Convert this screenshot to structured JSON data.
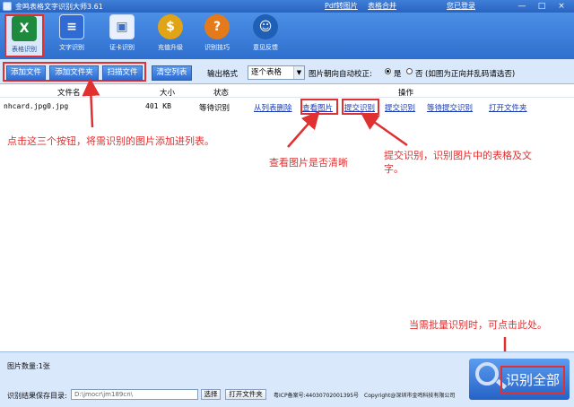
{
  "window": {
    "title": "金鸣表格文字识别大师3.61",
    "links": [
      "Pdf转图片",
      "表格合并",
      "您已登录"
    ],
    "controls": [
      "—",
      "□",
      "×"
    ]
  },
  "toolbar": {
    "tools": [
      {
        "label": "表格识别",
        "icon": "excel-icon",
        "color": "#1e8a3e"
      },
      {
        "label": "文字识别",
        "icon": "document-icon",
        "color": "#2f6bd3"
      },
      {
        "label": "证卡识别",
        "icon": "id-card-icon",
        "color": "#3b6fc2"
      },
      {
        "label": "充值升级",
        "icon": "coin-icon",
        "color": "#e0a416"
      },
      {
        "label": "识别技巧",
        "icon": "help-icon",
        "color": "#e57a1a"
      },
      {
        "label": "意见反馈",
        "icon": "feedback-icon",
        "color": "#1f5fb5"
      }
    ]
  },
  "actions": {
    "add_file": "添加文件",
    "add_folder": "添加文件夹",
    "scan_file": "扫描文件",
    "clear_list": "清空列表",
    "output_format_label": "输出格式",
    "output_format_value": "逐个表格",
    "orientation_label": "图片朝向自动校正:",
    "yes": "是",
    "no": "否",
    "orientation_hint": "(如图为正向并乱码请选否)"
  },
  "list": {
    "columns": [
      "文件名",
      "大小",
      "状态",
      "操作"
    ],
    "rows": [
      {
        "filename": "nhcard.jpg0.jpg",
        "size": "401 KB",
        "status": "等待识别",
        "ops": [
          "从列表删除",
          "查看图片",
          "提交识别",
          "提交识别",
          "等待提交识别",
          "打开文件夹"
        ]
      }
    ]
  },
  "annotations": {
    "add_buttons": "点击这三个按钮，将需识别的图片添加进列表。",
    "view_image": "查看图片是否清晰",
    "submit_line1": "提交识别，识别图片中的表格及文",
    "submit_line2": "字。",
    "batch": "当需批量识别时，可点击此处。"
  },
  "status": {
    "image_count": "图片数量:1张",
    "save_dir_label": "识别结果保存目录:",
    "save_dir_value": "D:\\jmocr\\jm189cn\\",
    "choose": "选择",
    "open_folder": "打开文件夹",
    "icp": "粤ICP备案号:44030702001395号",
    "copyright": "Copyright@深圳市金鸣科技有限公司",
    "recognize_all": "识别全部"
  },
  "colors": {
    "accent_red": "#e03030",
    "toolbar_blue": "#2f6fce",
    "panel": "#d9e8fb"
  }
}
